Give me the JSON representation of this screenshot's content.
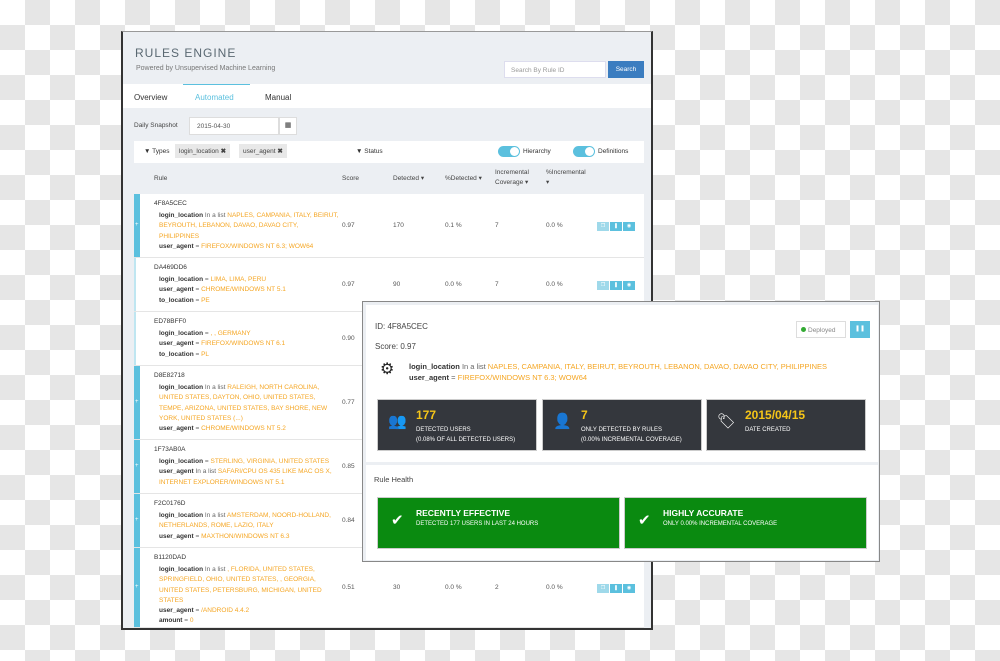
{
  "header": {
    "title": "RULES ENGINE",
    "subtitle": "Powered by Unsupervised Machine Learning",
    "search_placeholder": "Search By Rule ID",
    "search_button": "Search"
  },
  "tabs": [
    {
      "label": "Overview"
    },
    {
      "label": "Automated",
      "active": true
    },
    {
      "label": "Manual"
    }
  ],
  "snapshot": {
    "label": "Daily Snapshot",
    "value": "2015-04-30",
    "icon": "calendar-icon"
  },
  "filters": {
    "types_label": "Types",
    "chips": [
      "login_location",
      "user_agent"
    ],
    "status_label": "Status",
    "toggles": [
      {
        "label": "Hierarchy",
        "on": true
      },
      {
        "label": "Definitions",
        "on": true
      }
    ]
  },
  "table": {
    "headers": [
      "Rule",
      "Score",
      "Detected",
      "%Detected",
      "Incremental Coverage",
      "%Incremental"
    ],
    "rows": [
      {
        "id": "4F8A5CEC",
        "conds": [
          {
            "k": "login_location",
            "op": "In a list",
            "v": "NAPLES, CAMPANIA, ITALY, BEIRUT, BEYROUTH, LEBANON, DAVAO, DAVAO CITY, PHILIPPINES"
          },
          {
            "k": "user_agent",
            "op": "=",
            "v": "FIREFOX/WINDOWS NT 6.3; WOW64"
          }
        ],
        "score": "0.97",
        "detected": "170",
        "pct_detected": "0.1 %",
        "incremental": "7",
        "pct_incremental": "0.0 %"
      },
      {
        "id": "DA469DD6",
        "conds": [
          {
            "k": "login_location",
            "op": "=",
            "v": "LIMA, LIMA, PERU"
          },
          {
            "k": "user_agent",
            "op": "=",
            "v": "CHROME/WINDOWS NT 5.1"
          },
          {
            "k": "to_location",
            "op": "=",
            "v": "PE"
          }
        ],
        "score": "0.97",
        "detected": "90",
        "pct_detected": "0.0 %",
        "incremental": "7",
        "pct_incremental": "0.0 %"
      },
      {
        "id": "ED78BFF0",
        "conds": [
          {
            "k": "login_location",
            "op": "=",
            "v": ", , GERMANY"
          },
          {
            "k": "user_agent",
            "op": "=",
            "v": "FIREFOX/WINDOWS NT 6.1"
          },
          {
            "k": "to_location",
            "op": "=",
            "v": "PL"
          }
        ],
        "score": "0.90"
      },
      {
        "id": "D8E82718",
        "conds": [
          {
            "k": "login_location",
            "op": "In a list",
            "v": "RALEIGH, NORTH CAROLINA, UNITED STATES, DAYTON, OHIO, UNITED STATES, TEMPE, ARIZONA, UNITED STATES, BAY SHORE, NEW YORK, UNITED STATES (...)"
          },
          {
            "k": "user_agent",
            "op": "=",
            "v": "CHROME/WINDOWS NT 5.2"
          }
        ],
        "score": "0.77"
      },
      {
        "id": "1F73AB0A",
        "conds": [
          {
            "k": "login_location",
            "op": "=",
            "v": "STERLING, VIRGINIA, UNITED STATES"
          },
          {
            "k": "user_agent",
            "op": "In a list",
            "v": "SAFARI/CPU OS 435 LIKE MAC OS X, INTERNET EXPLORER/WINDOWS NT 5.1"
          }
        ],
        "score": "0.85"
      },
      {
        "id": "F2C0176D",
        "conds": [
          {
            "k": "login_location",
            "op": "In a list",
            "v": "AMSTERDAM, NOORD-HOLLAND, NETHERLANDS, ROME, LAZIO, ITALY"
          },
          {
            "k": "user_agent",
            "op": "=",
            "v": "MAXTHON/WINDOWS NT 6.3"
          }
        ],
        "score": "0.84"
      },
      {
        "id": "B1120DAD",
        "conds": [
          {
            "k": "login_location",
            "op": "In a list",
            "v": ", FLORIDA, UNITED STATES, SPRINGFIELD, OHIO, UNITED STATES, , GEORGIA, UNITED STATES, PETERSBURG, MICHIGAN, UNITED STATES"
          },
          {
            "k": "user_agent",
            "op": "=",
            "v": "/ANDROID 4.4.2"
          },
          {
            "k": "amount",
            "op": "=",
            "v": "0"
          }
        ],
        "score": "0.51",
        "detected": "30",
        "pct_detected": "0.0 %",
        "incremental": "2",
        "pct_incremental": "0.0 %"
      }
    ]
  },
  "detail": {
    "id": "ID: 4F8A5CEC",
    "score": "Score: 0.97",
    "status": "Deployed",
    "conds": [
      {
        "k": "login_location",
        "op": "In a list",
        "v": "NAPLES, CAMPANIA, ITALY, BEIRUT, BEYROUTH, LEBANON, DAVAO, DAVAO CITY, PHILIPPINES"
      },
      {
        "k": "user_agent",
        "op": "=",
        "v": "FIREFOX/WINDOWS NT 6.3; WOW64"
      }
    ],
    "stats": [
      {
        "icon": "users-icon",
        "value": "177",
        "l1": "DETECTED USERS",
        "l2": "(0.08% OF ALL DETECTED USERS)"
      },
      {
        "icon": "user-plus-icon",
        "value": "7",
        "l1": "ONLY DETECTED BY RULES",
        "l2": "(0.00% INCREMENTAL COVERAGE)"
      },
      {
        "icon": "tags-icon",
        "value": "2015/04/15",
        "l1": "DATE CREATED",
        "l2": ""
      }
    ],
    "health_title": "Rule Health",
    "health": [
      {
        "title": "RECENTLY EFFECTIVE",
        "sub": "DETECTED 177 USERS IN LAST 24 HOURS"
      },
      {
        "title": "HIGHLY ACCURATE",
        "sub": "ONLY 0.00% INCREMENTAL COVERAGE"
      }
    ]
  },
  "colors": {
    "accent": "#5bc0de",
    "primary": "#3b7dc0",
    "value": "#f5a623",
    "health": "#0a8a10",
    "stat_bg": "#34373d"
  }
}
